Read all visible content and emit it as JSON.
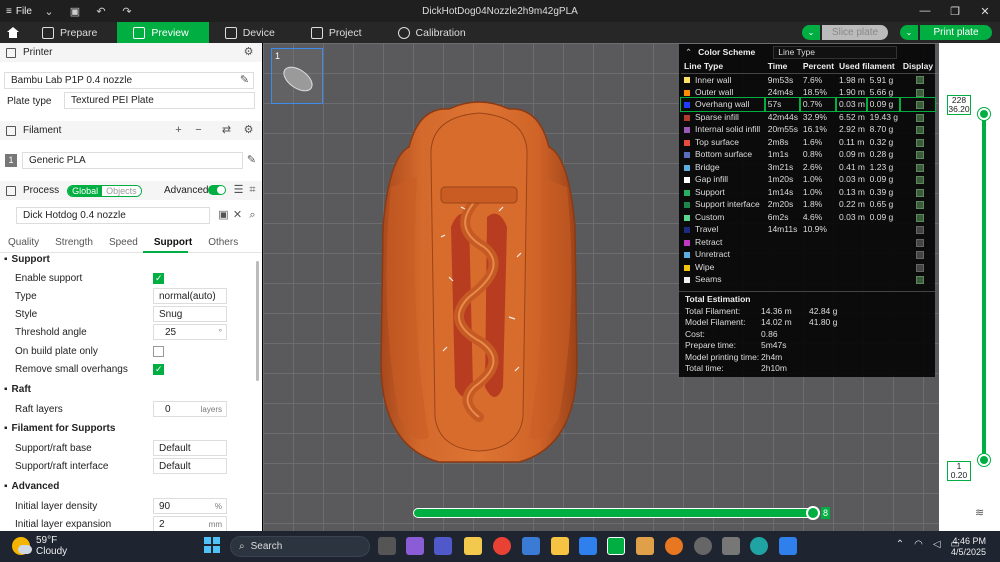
{
  "window": {
    "title": "DickHotDog04Nozzle2h9m42gPLA",
    "file_menu": "File"
  },
  "nav": {
    "tabs": [
      {
        "label": "Prepare"
      },
      {
        "label": "Preview"
      },
      {
        "label": "Device"
      },
      {
        "label": "Project"
      },
      {
        "label": "Calibration"
      }
    ],
    "slice_label": "Slice plate",
    "print_label": "Print plate"
  },
  "left": {
    "printer_title": "Printer",
    "printer_value": "Bambu Lab P1P 0.4 nozzle",
    "plate_type_label": "Plate type",
    "plate_type_value": "Textured PEI Plate",
    "filament_title": "Filament",
    "filament_index": "1",
    "filament_value": "Generic PLA",
    "process_title": "Process",
    "global_label": "Global",
    "objects_label": "Objects",
    "advanced_label": "Advanced",
    "process_value": "Dick Hotdog 0.4 nozzle",
    "tabs": [
      "Quality",
      "Strength",
      "Speed",
      "Support",
      "Others"
    ],
    "support_title": "Support",
    "enable_support": "Enable support",
    "type_label": "Type",
    "type_value": "normal(auto)",
    "style_label": "Style",
    "style_value": "Snug",
    "threshold_label": "Threshold angle",
    "threshold_value": "25",
    "threshold_unit": "°",
    "on_build_plate": "On build plate only",
    "remove_small": "Remove small overhangs",
    "raft_title": "Raft",
    "raft_layers_label": "Raft layers",
    "raft_layers_value": "0",
    "raft_layers_unit": "layers",
    "filament_supports_title": "Filament for Supports",
    "support_base_label": "Support/raft base",
    "support_base_value": "Default",
    "support_interface_label": "Support/raft interface",
    "support_interface_value": "Default",
    "advanced_title": "Advanced",
    "initial_density_label": "Initial layer density",
    "initial_density_value": "90",
    "initial_density_unit": "%",
    "initial_expansion_label": "Initial layer expansion",
    "initial_expansion_value": "2",
    "initial_expansion_unit": "mm"
  },
  "viewport": {
    "plate_number": "1"
  },
  "legend": {
    "title": "Color Scheme",
    "scheme": "Line Type",
    "headers": [
      "Line Type",
      "Time",
      "Percent",
      "Used filament",
      "Display"
    ],
    "rows": [
      {
        "name": "Inner wall",
        "color": "#ffe066",
        "time": "9m53s",
        "percent": "7.6%",
        "len": "1.98 m",
        "weight": "5.91 g",
        "display": true
      },
      {
        "name": "Outer wall",
        "color": "#ff8c00",
        "time": "24m4s",
        "percent": "18.5%",
        "len": "1.90 m",
        "weight": "5.66 g",
        "display": true
      },
      {
        "name": "Overhang wall",
        "color": "#1e3cff",
        "time": "57s",
        "percent": "0.7%",
        "len": "0.03 m",
        "weight": "0.09 g",
        "display": true
      },
      {
        "name": "Sparse infill",
        "color": "#b03a2e",
        "time": "42m44s",
        "percent": "32.9%",
        "len": "6.52 m",
        "weight": "19.43 g",
        "display": true
      },
      {
        "name": "Internal solid infill",
        "color": "#9b59b6",
        "time": "20m55s",
        "percent": "16.1%",
        "len": "2.92 m",
        "weight": "8.70 g",
        "display": true
      },
      {
        "name": "Top surface",
        "color": "#e74c3c",
        "time": "2m8s",
        "percent": "1.6%",
        "len": "0.11 m",
        "weight": "0.32 g",
        "display": true
      },
      {
        "name": "Bottom surface",
        "color": "#5d6dbe",
        "time": "1m1s",
        "percent": "0.8%",
        "len": "0.09 m",
        "weight": "0.28 g",
        "display": true
      },
      {
        "name": "Bridge",
        "color": "#5dade2",
        "time": "3m21s",
        "percent": "2.6%",
        "len": "0.41 m",
        "weight": "1.23 g",
        "display": true
      },
      {
        "name": "Gap infill",
        "color": "#ffffff",
        "time": "1m20s",
        "percent": "1.0%",
        "len": "0.03 m",
        "weight": "0.09 g",
        "display": true
      },
      {
        "name": "Support",
        "color": "#27ae60",
        "time": "1m14s",
        "percent": "1.0%",
        "len": "0.13 m",
        "weight": "0.39 g",
        "display": true
      },
      {
        "name": "Support interface",
        "color": "#1e8449",
        "time": "2m20s",
        "percent": "1.8%",
        "len": "0.22 m",
        "weight": "0.65 g",
        "display": true
      },
      {
        "name": "Custom",
        "color": "#58d68d",
        "time": "6m2s",
        "percent": "4.6%",
        "len": "0.03 m",
        "weight": "0.09 g",
        "display": true
      },
      {
        "name": "Travel",
        "color": "#1c2a80",
        "time": "14m11s",
        "percent": "10.9%",
        "len": "",
        "weight": "",
        "display": false
      },
      {
        "name": "Retract",
        "color": "#c039c0",
        "time": "",
        "percent": "",
        "len": "",
        "weight": "",
        "display": false
      },
      {
        "name": "Unretract",
        "color": "#5dade2",
        "time": "",
        "percent": "",
        "len": "",
        "weight": "",
        "display": false
      },
      {
        "name": "Wipe",
        "color": "#f1c40f",
        "time": "",
        "percent": "",
        "len": "",
        "weight": "",
        "display": false
      },
      {
        "name": "Seams",
        "color": "#f0f0f0",
        "time": "",
        "percent": "",
        "len": "",
        "weight": "",
        "display": true
      }
    ],
    "total_title": "Total Estimation",
    "totals": [
      {
        "k": "Total Filament:",
        "v1": "14.36 m",
        "v2": "42.84 g"
      },
      {
        "k": "Model Filament:",
        "v1": "14.02 m",
        "v2": "41.80 g"
      },
      {
        "k": "Cost:",
        "v1": "0.86",
        "v2": ""
      },
      {
        "k": "Prepare time:",
        "v1": "5m47s",
        "v2": ""
      },
      {
        "k": "Model printing time:",
        "v1": "2h4m",
        "v2": ""
      },
      {
        "k": "Total time:",
        "v1": "2h10m",
        "v2": ""
      }
    ]
  },
  "layers": {
    "top_layer": "228",
    "top_height": "36.20",
    "bottom_layer": "1",
    "bottom_height": "0.20",
    "move_index": "8"
  },
  "taskbar": {
    "temp": "59°F",
    "weather": "Cloudy",
    "search_placeholder": "Search",
    "time": "4:46 PM",
    "date": "4/5/2025"
  }
}
